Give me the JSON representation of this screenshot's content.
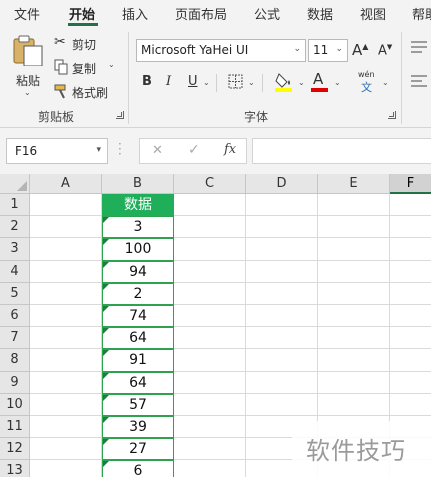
{
  "tabs": [
    "文件",
    "开始",
    "插入",
    "页面布局",
    "公式",
    "数据",
    "视图",
    "帮助"
  ],
  "ribbon": {
    "clipboard": {
      "paste": "粘贴",
      "cut": "剪切",
      "copy": "复制",
      "format_painter": "格式刷",
      "group_label": "剪贴板"
    },
    "font": {
      "font_name": "Microsoft YaHei UI",
      "font_size": "11",
      "bold": "B",
      "italic": "I",
      "underline": "U",
      "grow": "A",
      "shrink": "A",
      "font_color_letter": "A",
      "phonetic_top": "wén",
      "phonetic_bottom": "文",
      "group_label": "字体",
      "fill_color": "#ffff00",
      "font_color": "#e00000"
    }
  },
  "formula_bar": {
    "name_box": "F16",
    "cancel": "✕",
    "enter": "✓",
    "fx": "fx",
    "formula": ""
  },
  "grid": {
    "columns": [
      "A",
      "B",
      "C",
      "D",
      "E",
      "F"
    ],
    "selected_column": "F",
    "rows": [
      "1",
      "2",
      "3",
      "4",
      "5",
      "6",
      "7",
      "8",
      "9",
      "10",
      "11",
      "12",
      "13"
    ],
    "column_b": [
      "数据",
      "3",
      "100",
      "94",
      "2",
      "74",
      "64",
      "91",
      "64",
      "57",
      "39",
      "27",
      "6"
    ],
    "header_fill": "#1fae5a"
  },
  "watermark": "软件技巧"
}
